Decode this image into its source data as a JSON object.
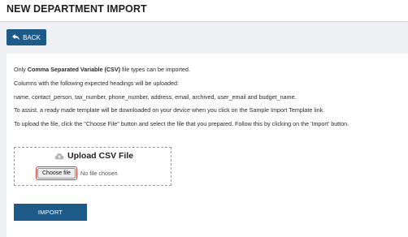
{
  "header": {
    "title": "NEW DEPARTMENT IMPORT"
  },
  "toolbar": {
    "back_label": "BACK",
    "back_icon": "reply-arrow-icon"
  },
  "instructions": {
    "line1_prefix": "Only ",
    "line1_bold": "Comma Separated Variable (CSV)",
    "line1_suffix": " file types can be imported.",
    "line2": "Columns with the following expected headings will be uploaded:",
    "line3": "name, contact_person, tax_number, phone_number, address, email, archived, user_email and budget_name.",
    "line4": "To assist, a ready made template will be downloaded on your device when you click on the Sample Import Template link.",
    "line5": "To upload the file, click the \"Choose File\" button and select the file that you prepared. Follow this by clicking on the 'Import' button."
  },
  "upload": {
    "title": "Upload CSV File",
    "icon": "cloud-upload-icon",
    "choose_label": "Choose file",
    "file_status": "No file chosen"
  },
  "actions": {
    "import_label": "IMPORT"
  },
  "colors": {
    "primary": "#1e5a87",
    "highlight": "#d33a36",
    "background": "#eef0f3"
  }
}
